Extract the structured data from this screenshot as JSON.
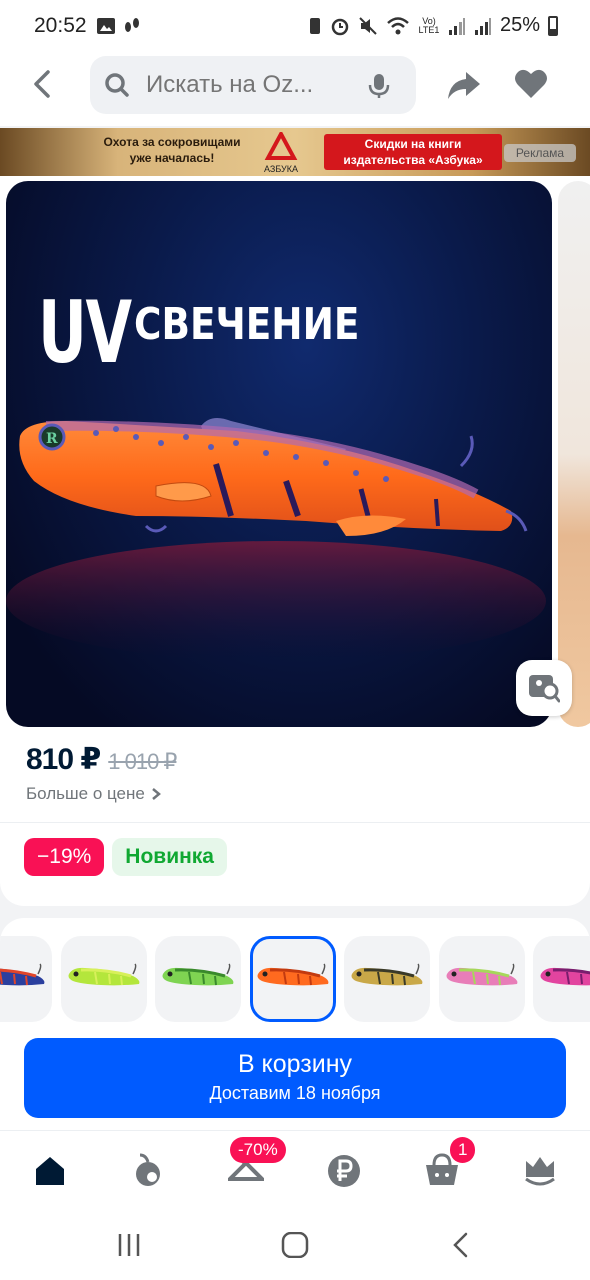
{
  "status_bar": {
    "time": "20:52",
    "battery_text": "25%",
    "lte_text": "Vo)\nLTE1"
  },
  "header": {
    "search_placeholder": "Искать на Oz..."
  },
  "ad": {
    "left_text": "Охота за сокровищами уже началась!",
    "logo_text": "АЗБУКА",
    "red_text": "Скидки на книги издательства «Азбука»",
    "badge": "Реклама"
  },
  "product": {
    "image_title_uv": "UV",
    "image_title_word": "СВЕЧЕНИЕ",
    "price_current": "810 ₽",
    "price_old": "1 010 ₽",
    "more_price": "Больше о цене",
    "badge_discount": "−19%",
    "badge_new": "Новинка"
  },
  "variants": [
    {
      "name": "blue",
      "body": "#2b3f9e",
      "accent": "#e0452a",
      "selected": false
    },
    {
      "name": "green-yellow",
      "body": "#b4e63c",
      "accent": "#d8f05a",
      "selected": false
    },
    {
      "name": "green",
      "body": "#7fd452",
      "accent": "#3a8a2c",
      "selected": false
    },
    {
      "name": "orange",
      "body": "#ff6a1f",
      "accent": "#c23a10",
      "selected": true
    },
    {
      "name": "gold-brown",
      "body": "#c9a848",
      "accent": "#3a3a28",
      "selected": false
    },
    {
      "name": "pink-green",
      "body": "#e87db8",
      "accent": "#a6d85a",
      "selected": false
    },
    {
      "name": "magenta",
      "body": "#e2449f",
      "accent": "#7a1e6e",
      "selected": false
    }
  ],
  "cart": {
    "title": "В корзину",
    "subtitle": "Доставим 18 ноября"
  },
  "nav": {
    "sale_badge": "-70%",
    "cart_badge": "1"
  },
  "colors": {
    "accent": "#005bff",
    "discount": "#f91155",
    "new_badge": "#10a832"
  }
}
